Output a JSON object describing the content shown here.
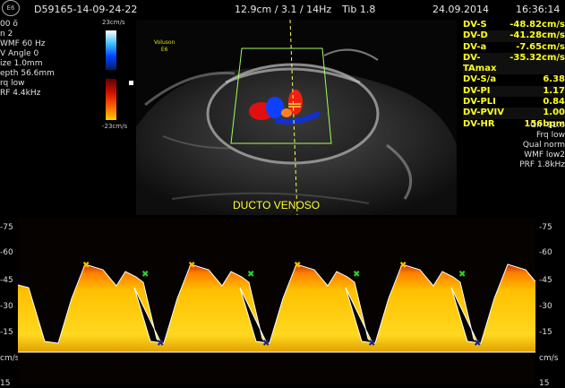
{
  "header": {
    "patient_id": "D59165-14-09-24-22",
    "probe_info": "12.9cm / 3.1 / 14Hz",
    "tib": "Tib  1.8",
    "date": "24.09.2014",
    "time": "16:36:14",
    "logo_text": "E6"
  },
  "left_params": [
    "00 õ",
    "n  2",
    "WMF 60 Hz",
    "V Angle  0",
    "ize  1.0mm",
    "epth 56.6mm",
    "rq low",
    "RF  4.4kHz"
  ],
  "color_scale": {
    "top": "23cm/s",
    "bottom": "-23cm/s"
  },
  "image_pane": {
    "logo_line1": "Voluson",
    "logo_line2": "E6",
    "label": "DUCTO VENOSO"
  },
  "measurements": [
    {
      "name": "DV-S",
      "value": "-48.82cm/s"
    },
    {
      "name": "DV-D",
      "value": "-41.28cm/s"
    },
    {
      "name": "DV-a",
      "value": "-7.65cm/s"
    },
    {
      "name": "DV-TAmax",
      "value": "-35.32cm/s"
    },
    {
      "name": "DV-S/a",
      "value": "6.38"
    },
    {
      "name": "DV-PI",
      "value": "1.17"
    },
    {
      "name": "DV-PLI",
      "value": "0.84"
    },
    {
      "name": "DV-PVIV",
      "value": "1.00"
    },
    {
      "name": "DV-HR",
      "value": "156bpm"
    }
  ],
  "right_params": [
    "Gn -11.6",
    "Frq low",
    "Qual norm",
    "WMF low2",
    "PRF  1.8kHz"
  ],
  "spectrum_scale": {
    "ticks": [
      "-75",
      "-60",
      "-45",
      "-30",
      "-15",
      "cm/s",
      "15"
    ],
    "left_unit": "cm/s",
    "right_unit": "cm/s"
  },
  "colors": {
    "measure": "#ffff20",
    "doppler_yellow": "#ffc000",
    "trace": "#ffffff",
    "caliper_green": "#30d030",
    "caliper_blue": "#202080"
  }
}
